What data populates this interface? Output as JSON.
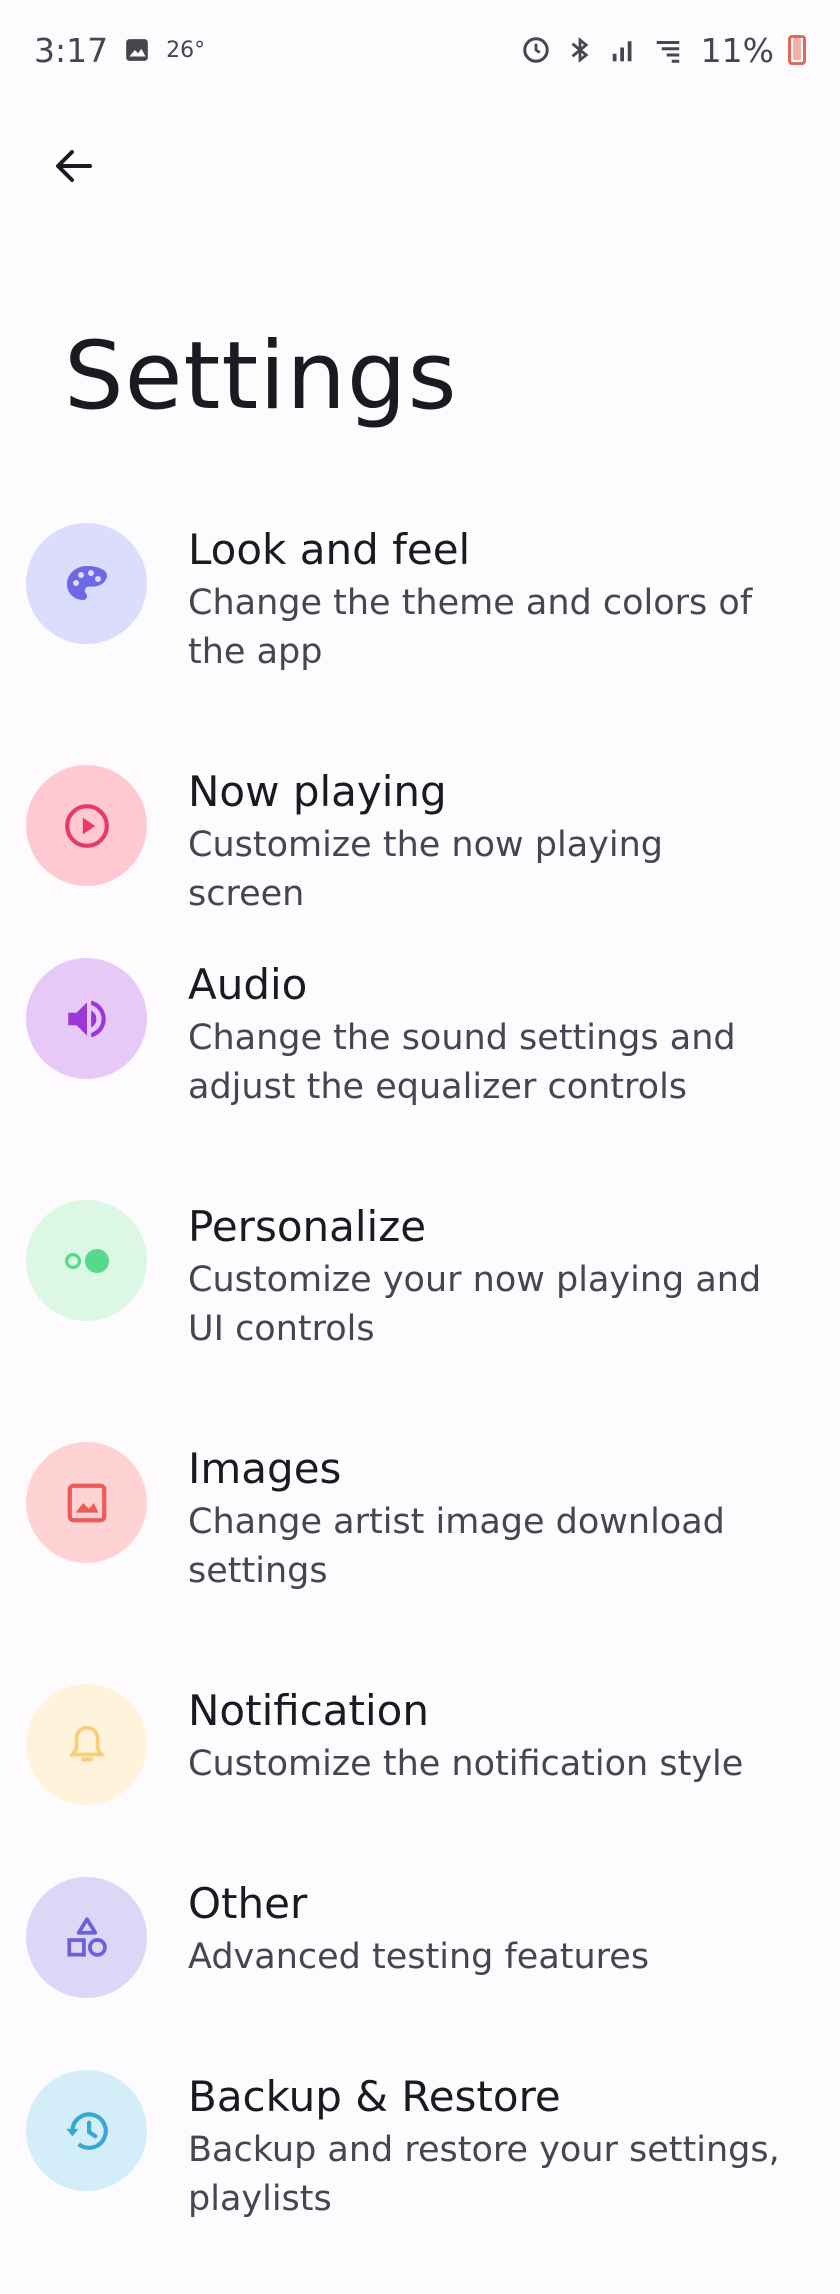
{
  "status_bar": {
    "time": "3:17",
    "temperature": "26°",
    "battery_percent": "11%",
    "icons": [
      "gallery-icon",
      "alarm-icon",
      "bluetooth-icon",
      "signal-icon",
      "wifi-icon",
      "battery-icon"
    ]
  },
  "header": {
    "back_icon": "arrow-back-icon",
    "title": "Settings"
  },
  "settings": [
    {
      "title": "Look and feel",
      "subtitle": "Change the theme and colors of the app",
      "icon": "palette-icon",
      "bg": "#dcdcfc",
      "fg": "#6d68e6"
    },
    {
      "title": "Now playing",
      "subtitle": "Customize the now playing screen",
      "icon": "play-circle-icon",
      "bg": "#ffc9d1",
      "fg": "#e63c64"
    },
    {
      "title": "Audio",
      "subtitle": "Change the sound settings and adjust the equalizer controls",
      "icon": "volume-icon",
      "bg": "#e6c9f7",
      "fg": "#9e35d8"
    },
    {
      "title": "Personalize",
      "subtitle": "Customize your now playing and UI controls",
      "icon": "toggle-icon",
      "bg": "#dcf7e4",
      "fg": "#55d98b"
    },
    {
      "title": "Images",
      "subtitle": "Change artist image download settings",
      "icon": "image-icon",
      "bg": "#ffd3d3",
      "fg": "#ee5a5a"
    },
    {
      "title": "Notification",
      "subtitle": "Customize the notification style",
      "icon": "bell-icon",
      "bg": "#fff3dc",
      "fg": "#f7cf7c"
    },
    {
      "title": "Other",
      "subtitle": "Advanced testing features",
      "icon": "shapes-icon",
      "bg": "#dcd6f7",
      "fg": "#6c5fdc"
    },
    {
      "title": "Backup & Restore",
      "subtitle": "Backup and restore your settings, playlists",
      "icon": "restore-icon",
      "bg": "#d3eef9",
      "fg": "#3aa6d6"
    }
  ]
}
